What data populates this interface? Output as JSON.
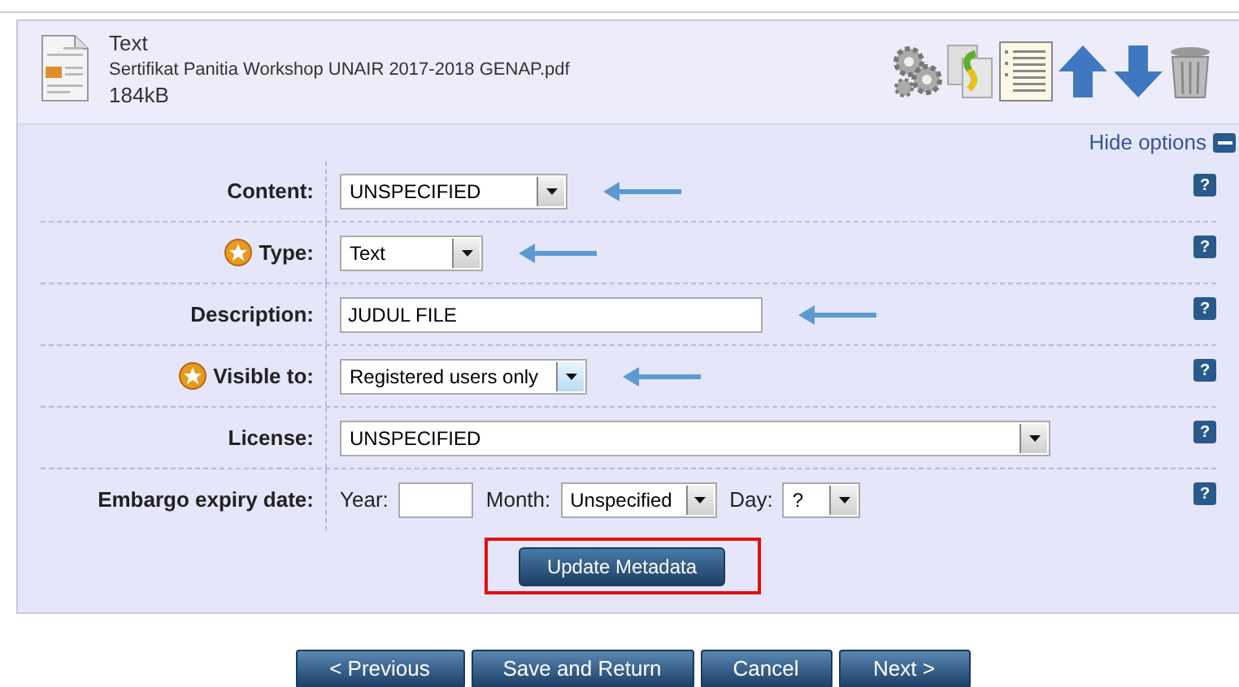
{
  "file": {
    "type": "Text",
    "name": "Sertifikat Panitia Workshop UNAIR 2017-2018 GENAP.pdf",
    "size": "184kB"
  },
  "hide_options": "Hide options",
  "fields": [
    {
      "kind": "select",
      "label": "Content:",
      "required": false,
      "value": "UNSPECIFIED",
      "help": "?"
    },
    {
      "kind": "select",
      "label": "Type:",
      "required": true,
      "value": "Text",
      "help": "?"
    },
    {
      "kind": "text",
      "label": "Description:",
      "required": false,
      "value": "JUDUL FILE",
      "help": "?"
    },
    {
      "kind": "select",
      "label": "Visible to:",
      "required": true,
      "value": "Registered users only",
      "help": "?"
    },
    {
      "kind": "select",
      "label": "License:",
      "required": false,
      "value": "UNSPECIFIED",
      "help": "?"
    },
    {
      "kind": "date",
      "label": "Embargo expiry date:",
      "required": false,
      "year_label": "Year:",
      "month_label": "Month:",
      "month": "Unspecified",
      "day_label": "Day:",
      "day": "?",
      "help": "?"
    }
  ],
  "update_button": "Update Metadata",
  "buttons": [
    "< Previous",
    "Save and Return",
    "Cancel",
    "Next >"
  ]
}
